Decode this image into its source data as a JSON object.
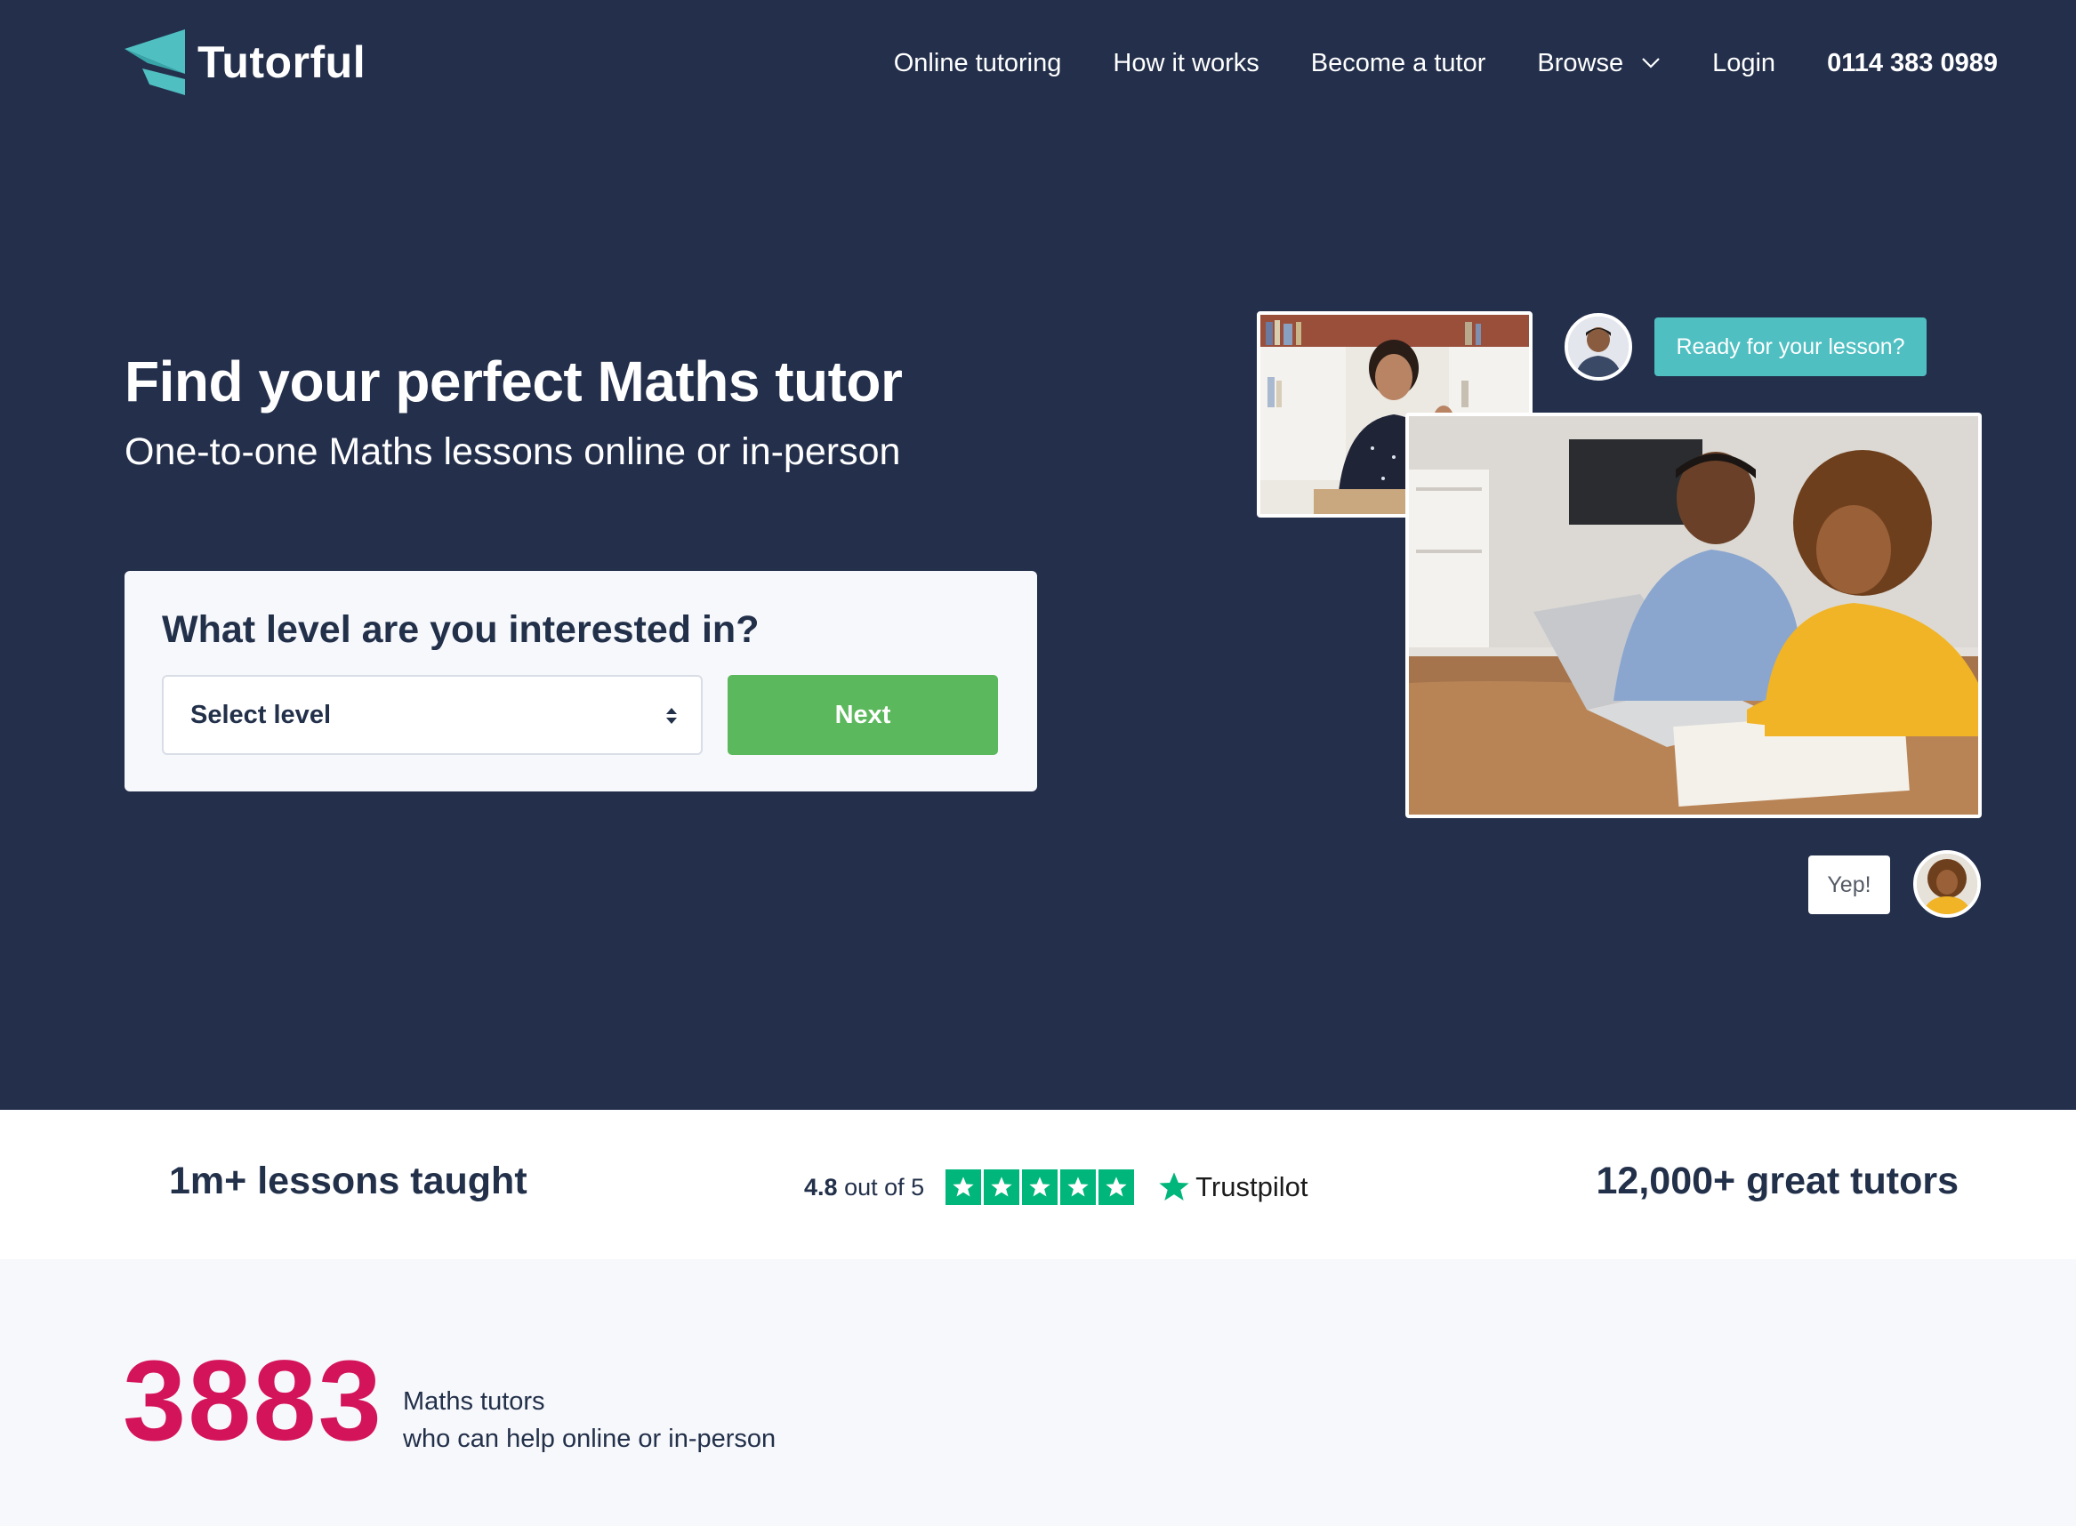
{
  "brand": {
    "name": "Tutorful",
    "accent": "#4fbfc2",
    "navy": "#232f4b"
  },
  "nav": {
    "items": [
      "Online tutoring",
      "How it works",
      "Become a tutor",
      "Browse",
      "Login"
    ],
    "phone": "0114 383 0989"
  },
  "hero": {
    "title": "Find your perfect Maths tutor",
    "subtitle": "One-to-one Maths lessons online or in-person"
  },
  "form": {
    "question": "What level are you interested in?",
    "select_value": "Select level",
    "next_label": "Next",
    "next_color": "#5cb85c"
  },
  "illustration": {
    "bubble_tutor": "Ready for your lesson?",
    "bubble_student": "Yep!"
  },
  "stats": {
    "lessons": "1m+ lessons taught",
    "tutors": "12,000+ great tutors",
    "trustpilot": {
      "score": "4.8",
      "score_suffix": "out of 5",
      "brand": "Trustpilot",
      "stars": 5,
      "color": "#00b67a"
    }
  },
  "count": {
    "number": "3883",
    "line1": "Maths tutors",
    "line2": "who can help online or in-person",
    "color": "#d4145a"
  }
}
